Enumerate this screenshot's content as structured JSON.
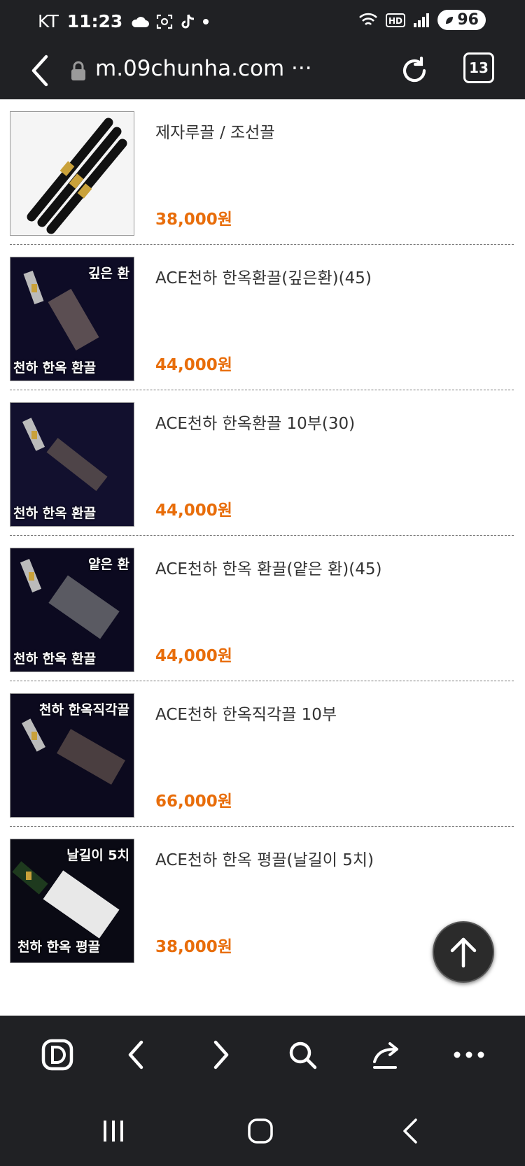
{
  "status_bar": {
    "carrier": "KT",
    "time": "11:23",
    "battery": "96"
  },
  "browser": {
    "url": "m.09chunha.com ···",
    "tab_count": "13"
  },
  "products": [
    {
      "name": "제자루끌 / 조선끌",
      "price": "38,000원",
      "caption_top": "",
      "caption_bottom": ""
    },
    {
      "name": "ACE천하 한옥환끌(깊은환)(45)",
      "price": "44,000원",
      "caption_top": "깊은 환",
      "caption_bottom": "천하 한옥 환끌"
    },
    {
      "name": "ACE천하 한옥환끌 10부(30)",
      "price": "44,000원",
      "caption_top": "",
      "caption_bottom": "천하 한옥 환끌"
    },
    {
      "name": "ACE천하 한옥 환끌(얕은 환)(45)",
      "price": "44,000원",
      "caption_top": "얕은 환",
      "caption_bottom": "천하 한옥 환끌"
    },
    {
      "name": "ACE천하 한옥직각끌 10부",
      "price": "66,000원",
      "caption_top": "천하 한옥직각끌",
      "caption_bottom": ""
    },
    {
      "name": "ACE천하 한옥 평끌(날길이 5치)",
      "price": "38,000원",
      "caption_top": "날길이 5치",
      "caption_bottom": "천하 한옥 평끌"
    }
  ],
  "colors": {
    "price": "#e86d0a",
    "chrome_bg": "#202124"
  }
}
